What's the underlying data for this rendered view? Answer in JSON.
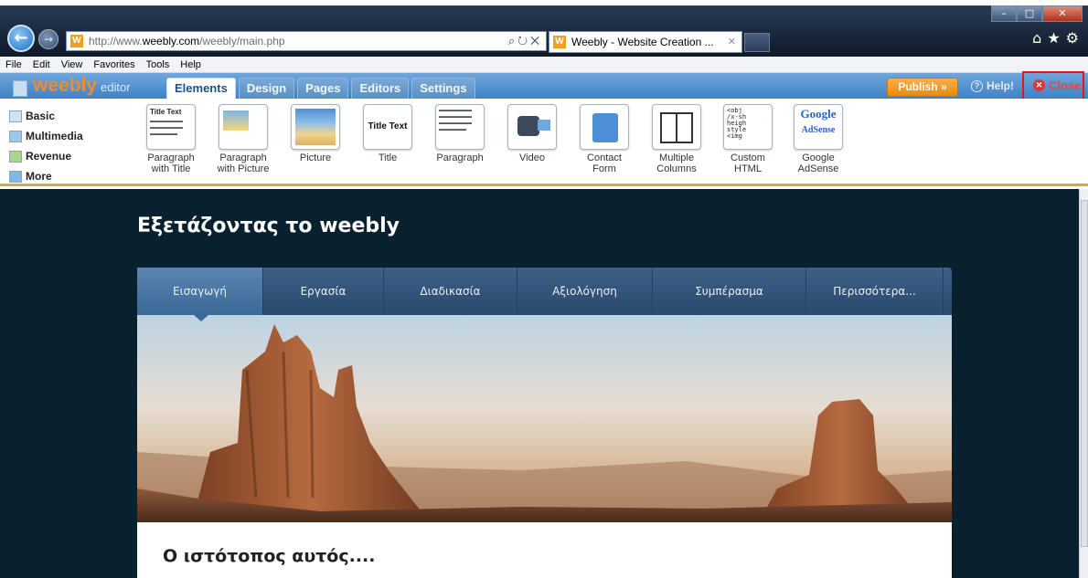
{
  "browser": {
    "url_prefix": "http://www.",
    "url_domain": "weebly.com",
    "url_path": "/weebly/main.php",
    "tab_title": "Weebly - Website Creation ...",
    "favicon_letter": "W"
  },
  "menubar": [
    "File",
    "Edit",
    "View",
    "Favorites",
    "Tools",
    "Help"
  ],
  "weebly": {
    "logo": "weebly",
    "logo_suffix": "editor",
    "tabs": [
      "Elements",
      "Design",
      "Pages",
      "Editors",
      "Settings"
    ],
    "publish": "Publish »",
    "help": "Help!",
    "close": "Close"
  },
  "categories": [
    "Basic",
    "Multimedia",
    "Revenue",
    "More"
  ],
  "elements": [
    {
      "label1": "Paragraph",
      "label2": "with Title"
    },
    {
      "label1": "Paragraph",
      "label2": "with Picture"
    },
    {
      "label1": "Picture",
      "label2": ""
    },
    {
      "label1": "Title",
      "label2": ""
    },
    {
      "label1": "Paragraph",
      "label2": ""
    },
    {
      "label1": "Video",
      "label2": ""
    },
    {
      "label1": "Contact",
      "label2": "Form"
    },
    {
      "label1": "Multiple",
      "label2": "Columns"
    },
    {
      "label1": "Custom",
      "label2": "HTML"
    },
    {
      "label1": "Google",
      "label2": "AdSense"
    }
  ],
  "thumbs": {
    "title_text": "Title Text",
    "title_big": "Title Text",
    "adsense_1": "Google",
    "adsense_2": "AdSense"
  },
  "site": {
    "title": "Εξετάζοντας το weebly",
    "nav": [
      "Εισαγωγή",
      "Εργασία",
      "Διαδικασία",
      "Αξιολόγηση",
      "Συμπέρασμα",
      "Περισσότερα..."
    ],
    "content_heading": "Ο ιστότοπος αυτός...."
  }
}
